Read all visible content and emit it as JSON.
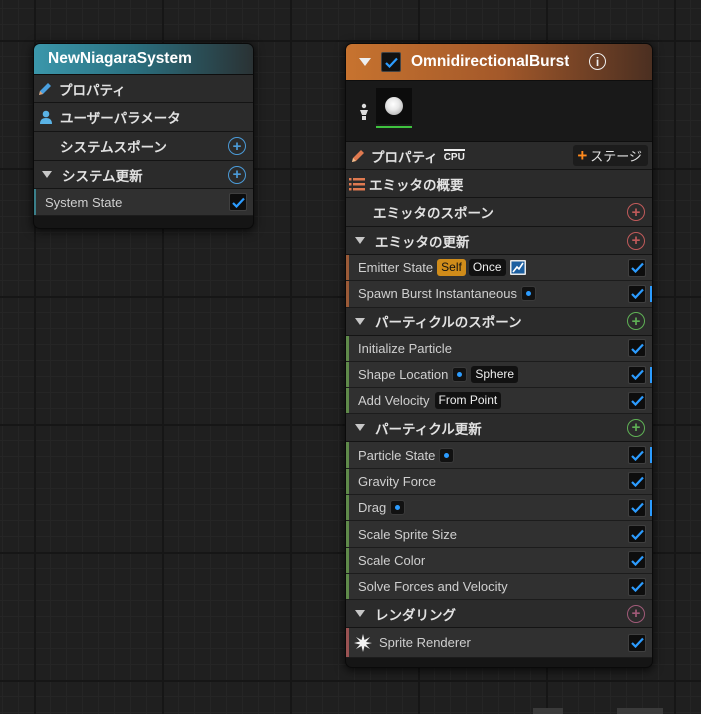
{
  "system_node": {
    "title": "NewNiagaraSystem",
    "rows": [
      {
        "label": "プロパティ",
        "icon": "pencil-icon"
      },
      {
        "label": "ユーザーパラメータ",
        "icon": "user-icon"
      },
      {
        "label": "システムスポーン",
        "action": "add"
      },
      {
        "label": "システム更新",
        "action": "add"
      }
    ],
    "module": {
      "label": "System State",
      "enabled": true
    }
  },
  "emitter_node": {
    "title": "OmnidirectionalBurst",
    "enabled": true,
    "properties_label": "プロパティ",
    "sim_target": "CPU",
    "add_stage_label": "ステージ",
    "summary_label": "エミッタの概要",
    "emitter_spawn_label": "エミッタのスポーン",
    "emitter_update": {
      "label": "エミッタの更新",
      "modules": [
        {
          "label": "Emitter State",
          "tags": [
            "Self",
            "Once"
          ],
          "enabled": true
        },
        {
          "label": "Spawn Burst Instantaneous",
          "enabled": true
        }
      ]
    },
    "particle_spawn": {
      "label": "パーティクルのスポーン",
      "modules": [
        {
          "label": "Initialize Particle",
          "enabled": true
        },
        {
          "label": "Shape Location",
          "tag": "Sphere",
          "enabled": true
        },
        {
          "label": "Add Velocity",
          "tag": "From Point",
          "enabled": true
        }
      ]
    },
    "particle_update": {
      "label": "パーティクル更新",
      "modules": [
        {
          "label": "Particle State",
          "enabled": true
        },
        {
          "label": "Gravity Force",
          "enabled": true
        },
        {
          "label": "Drag",
          "enabled": true
        },
        {
          "label": "Scale Sprite Size",
          "enabled": true
        },
        {
          "label": "Scale Color",
          "enabled": true
        },
        {
          "label": "Solve Forces and Velocity",
          "enabled": true
        }
      ]
    },
    "render": {
      "label": "レンダリング",
      "modules": [
        {
          "label": "Sprite Renderer",
          "enabled": true
        }
      ]
    }
  },
  "colors": {
    "system_header": "#2d7f8f",
    "emitter_header": "#b4642c",
    "check": "#2c9cff"
  }
}
